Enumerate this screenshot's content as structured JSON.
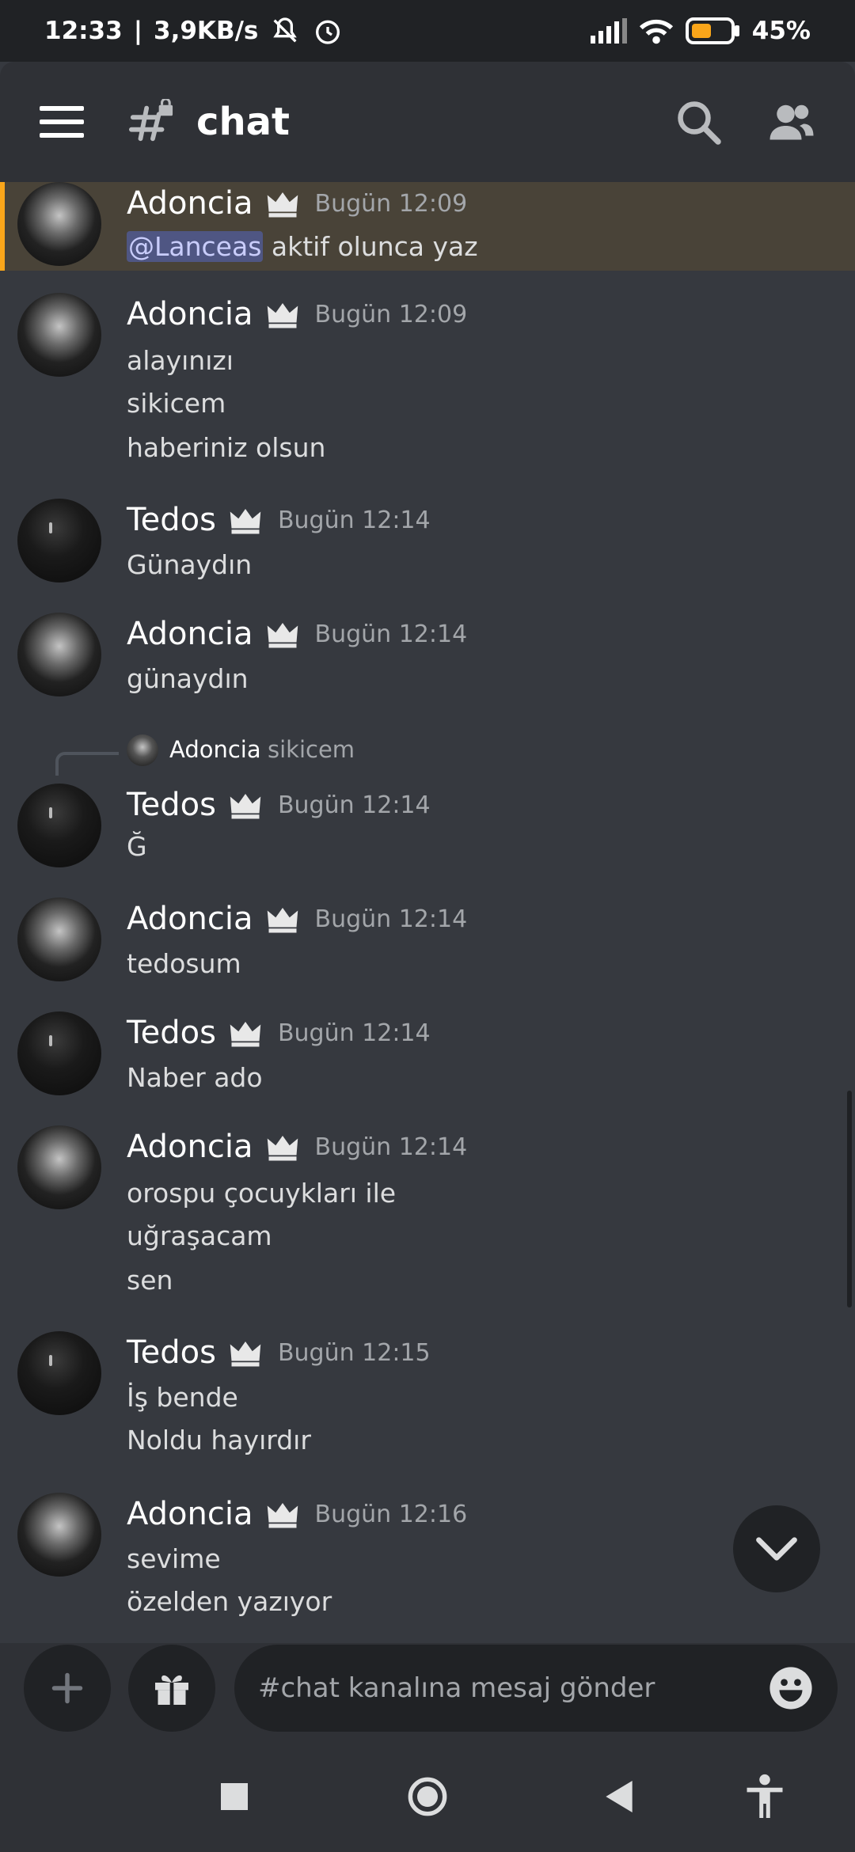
{
  "status": {
    "time": "12:33",
    "speed": "3,9KB/s",
    "battery": "45%"
  },
  "header": {
    "title": "chat"
  },
  "reply": {
    "name": "Adoncia",
    "text": "sikicem"
  },
  "messages": [
    {
      "user": "Adoncia",
      "time": "Bugün 12:09",
      "mention": "@Lanceas",
      "lines": [
        "aktif olunca yaz"
      ]
    },
    {
      "user": "Adoncia",
      "time": "Bugün 12:09",
      "lines": [
        "alayınızı",
        "sikicem",
        "haberiniz olsun"
      ]
    },
    {
      "user": "Tedos",
      "time": "Bugün 12:14",
      "lines": [
        "Günaydın"
      ]
    },
    {
      "user": "Adoncia",
      "time": "Bugün 12:14",
      "lines": [
        "günaydın"
      ]
    },
    {
      "user": "Tedos",
      "time": "Bugün 12:14",
      "lines": [
        "Ğ"
      ]
    },
    {
      "user": "Adoncia",
      "time": "Bugün 12:14",
      "lines": [
        "tedosum"
      ]
    },
    {
      "user": "Tedos",
      "time": "Bugün 12:14",
      "lines": [
        "Naber ado"
      ]
    },
    {
      "user": "Adoncia",
      "time": "Bugün 12:14",
      "lines": [
        "orospu çocuykları ile",
        "uğraşacam",
        "sen"
      ]
    },
    {
      "user": "Tedos",
      "time": "Bugün 12:15",
      "lines": [
        "İş bende",
        "Noldu hayırdır"
      ]
    },
    {
      "user": "Adoncia",
      "time": "Bugün 12:16",
      "lines": [
        "sevime",
        "özelden yazıyor"
      ]
    }
  ],
  "composer": {
    "placeholder": "#chat kanalına mesaj gönder"
  },
  "icons": {
    "menu": "hamburger-icon",
    "channel": "locked-hashtag-icon",
    "search": "search-icon",
    "members": "members-icon",
    "crown": "crown-icon",
    "jump": "chevron-down-icon",
    "add": "plus-icon",
    "gift": "gift-icon",
    "emoji": "emoji-icon"
  },
  "colors": {
    "background": "#36393f",
    "header": "#2f3136",
    "highlight": "#494338",
    "highlight_bar": "#faa61a",
    "mention_bg": "#4f5683"
  }
}
